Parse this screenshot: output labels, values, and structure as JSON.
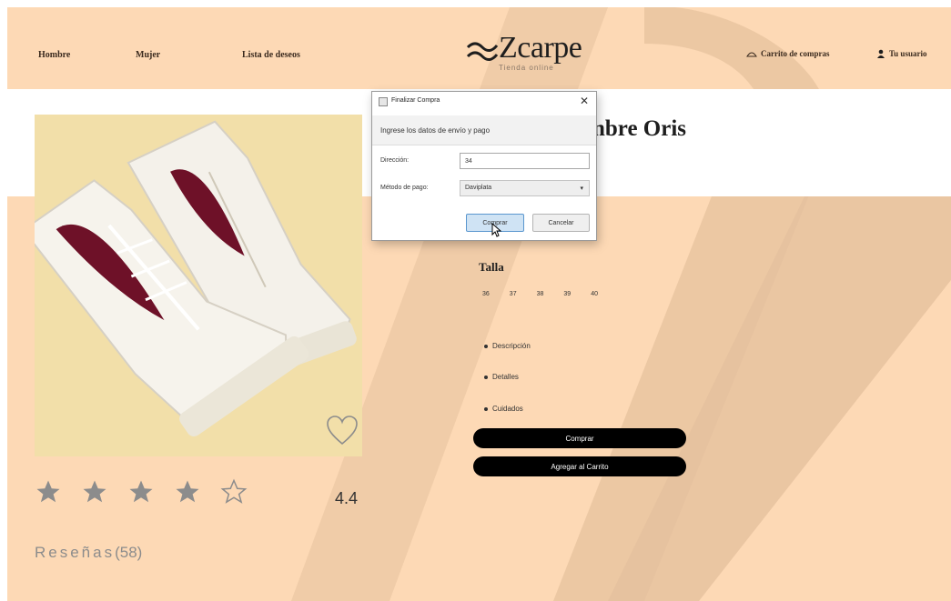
{
  "nav": {
    "links": [
      "Hombre",
      "Mujer",
      "Lista de deseos"
    ],
    "logo_text": "Zcarpe",
    "logo_subtitle": "Tienda online",
    "cart_label": "Carrito de compras",
    "user_label": "Tu usuario"
  },
  "product": {
    "title_visible": "nbre Oris",
    "rating": {
      "value": "4.4",
      "filled_stars": 4,
      "total_stars": 5
    },
    "reviews_label": "Reseñas",
    "reviews_count": "(58)",
    "size_label": "Talla",
    "sizes": [
      "36",
      "37",
      "38",
      "39",
      "40"
    ],
    "accordion": [
      "Descripción",
      "Detalles",
      "Cuidados"
    ],
    "buy_button": "Comprar",
    "add_to_cart_button": "Agregar al Carrito"
  },
  "dialog": {
    "title": "Finalizar Compra",
    "header": "Ingrese los datos de envío y pago",
    "address_label": "Dirección:",
    "address_value": "34",
    "payment_label": "Método de pago:",
    "payment_value": "Daviplata",
    "confirm_button": "Comprar",
    "cancel_button": "Cancelar"
  },
  "colors": {
    "background_peach": "#fdd9b5",
    "stripe": "#e5c19d",
    "image_bg": "#f2dfa9",
    "shoe_accent": "#6e1128",
    "button_black": "#000000",
    "dialog_primary": "#cfe3f4"
  }
}
